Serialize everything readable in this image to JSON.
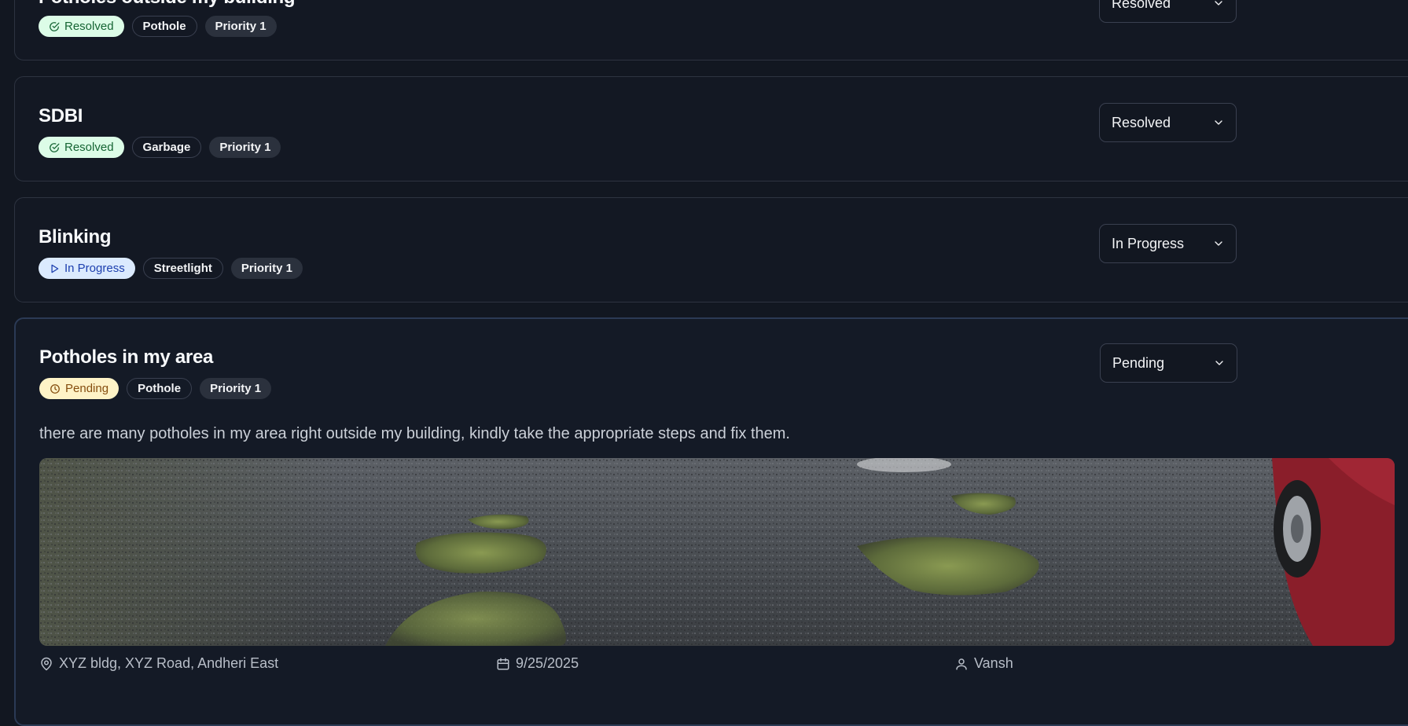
{
  "complaints": [
    {
      "title": "Potholes outside my building",
      "status_label": "Resolved",
      "category": "Pothole",
      "priority": "Priority 1",
      "select_value": "Resolved"
    },
    {
      "title": "SDBI",
      "status_label": "Resolved",
      "category": "Garbage",
      "priority": "Priority 1",
      "select_value": "Resolved"
    },
    {
      "title": "Blinking",
      "status_label": "In Progress",
      "category": "Streetlight",
      "priority": "Priority 1",
      "select_value": "In Progress"
    },
    {
      "title": "Potholes in my area",
      "status_label": "Pending",
      "category": "Pothole",
      "priority": "Priority 1",
      "select_value": "Pending",
      "description": "there are many potholes in my area right outside my building, kindly take the appropriate steps and fix them.",
      "location": "XYZ bldg, XYZ Road, Andheri East",
      "date": "9/25/2025",
      "reporter": "Vansh"
    }
  ],
  "colors": {
    "background": "#121721",
    "resolved_badge": "#dcfce7",
    "in_progress_badge": "#dbeafe",
    "pending_badge": "#fef3c7"
  },
  "icons": {
    "resolved": "check-circle-icon",
    "in_progress": "play-icon",
    "pending": "clock-icon",
    "dropdown": "chevron-down-icon",
    "location": "map-pin-icon",
    "date": "calendar-icon",
    "reporter": "user-icon"
  }
}
